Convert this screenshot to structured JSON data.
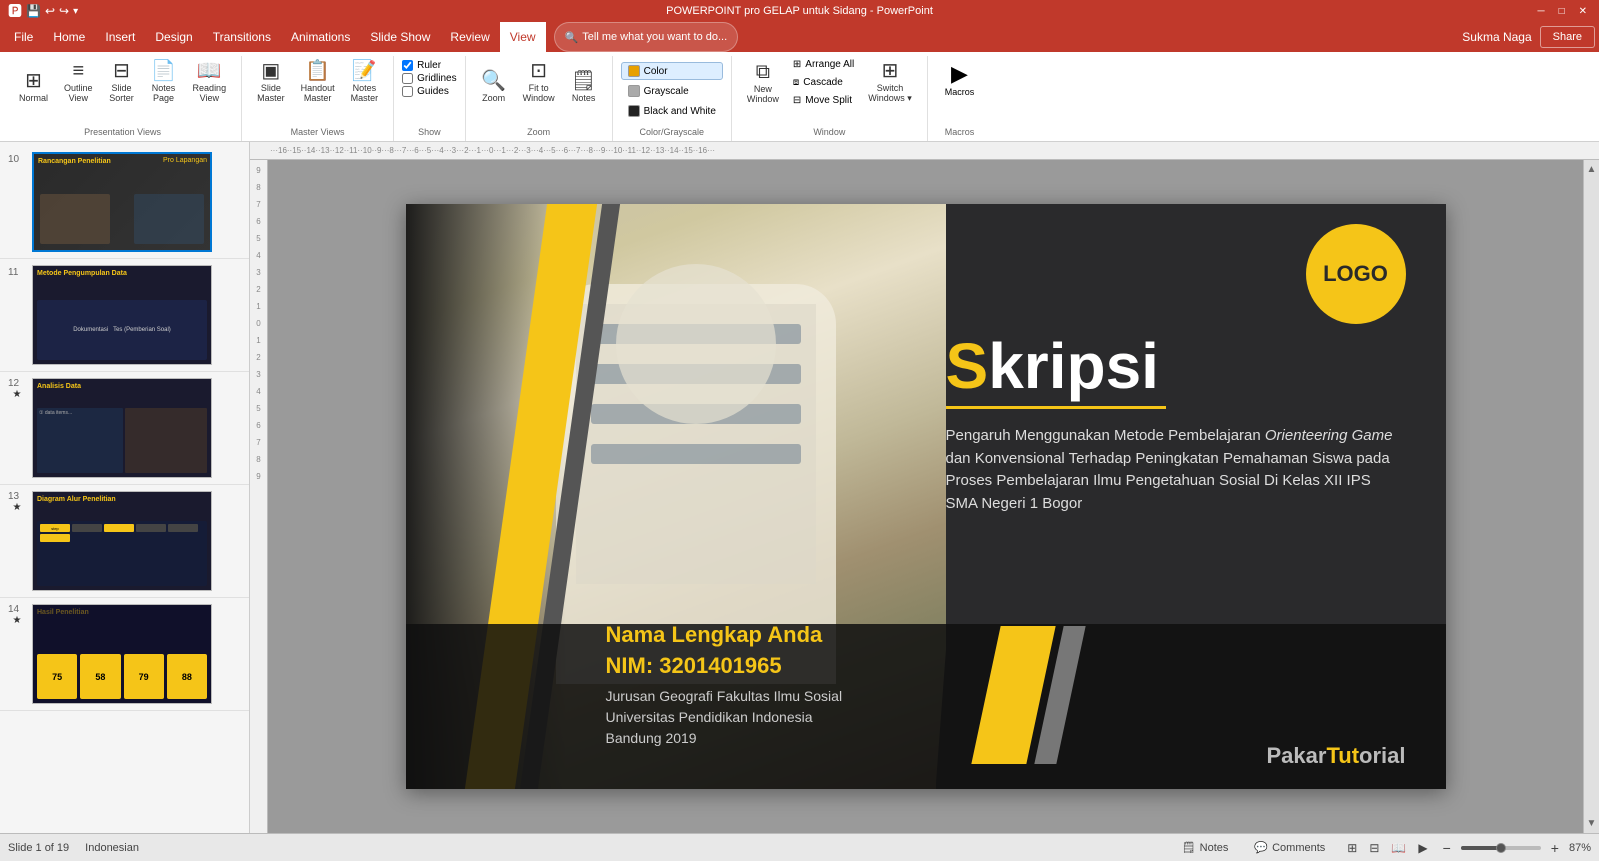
{
  "titlebar": {
    "title": "POWERPOINT pro GELAP untuk Sidang - PowerPoint",
    "controls": [
      "–",
      "□",
      "✕"
    ]
  },
  "qat": {
    "buttons": [
      "💾",
      "↩",
      "↪",
      "⚙",
      "💾",
      "▾"
    ]
  },
  "menubar": {
    "items": [
      "File",
      "Home",
      "Insert",
      "Design",
      "Transitions",
      "Animations",
      "Slide Show",
      "Review",
      "View"
    ],
    "active": "View",
    "tell_me": "Tell me what you want to do...",
    "user": "Sukma Naga",
    "share": "Share"
  },
  "ribbon": {
    "presentation_views": {
      "label": "Presentation Views",
      "buttons": [
        {
          "label": "Normal",
          "icon": "⊞"
        },
        {
          "label": "Outline\nView",
          "icon": "≡"
        },
        {
          "label": "Slide\nSorter",
          "icon": "⊟"
        },
        {
          "label": "Notes\nPage",
          "icon": "📄"
        },
        {
          "label": "Reading\nView",
          "icon": "📖"
        }
      ]
    },
    "master_views": {
      "label": "Master Views",
      "buttons": [
        {
          "label": "Slide\nMaster",
          "icon": "▣"
        },
        {
          "label": "Handout\nMaster",
          "icon": "📋"
        },
        {
          "label": "Notes\nMaster",
          "icon": "📝"
        }
      ]
    },
    "show": {
      "label": "Show",
      "checkboxes": [
        {
          "label": "Ruler",
          "checked": true
        },
        {
          "label": "Gridlines",
          "checked": false
        },
        {
          "label": "Guides",
          "checked": false
        }
      ]
    },
    "zoom": {
      "label": "Zoom",
      "buttons": [
        {
          "label": "Zoom",
          "icon": "🔍"
        },
        {
          "label": "Fit to\nWindow",
          "icon": "⊡"
        },
        {
          "label": "Notes",
          "icon": "🗒"
        }
      ]
    },
    "color": {
      "label": "Color/Grayscale",
      "items": [
        {
          "label": "Color",
          "active": true,
          "color": "#e8a000"
        },
        {
          "label": "Grayscale",
          "active": false,
          "color": "#aaa"
        },
        {
          "label": "Black and White",
          "active": false,
          "color": "#222"
        }
      ]
    },
    "window": {
      "label": "Window",
      "big_btn": {
        "label": "New\nWindow",
        "icon": "⧉"
      },
      "small_btns": [
        {
          "label": "Arrange All"
        },
        {
          "label": "Cascade"
        },
        {
          "label": "Move Split"
        }
      ],
      "switch_btn": {
        "label": "Switch\nWindows",
        "icon": "⊞"
      }
    },
    "macros": {
      "label": "Macros",
      "btn": {
        "label": "Macros",
        "icon": "▶"
      }
    }
  },
  "slides": [
    {
      "num": "10",
      "star": false,
      "label": "Rancangan Penelitian",
      "sublabel": "Pro Lapangan",
      "bg": "#2a2a2a"
    },
    {
      "num": "11",
      "star": false,
      "label": "Metode Pengumpulan Data",
      "bg": "#1a1a2e"
    },
    {
      "num": "12",
      "star": true,
      "label": "Analisis Data",
      "bg": "#1a1a2e"
    },
    {
      "num": "13",
      "star": true,
      "label": "Diagram Alur Penelitian",
      "bg": "#1a1a2e"
    },
    {
      "num": "14",
      "star": true,
      "label": "Hasil Penelitian",
      "bg": "#1a1a2e"
    }
  ],
  "slide_content": {
    "logo": "LOGO",
    "title_prefix": "S",
    "title_rest": "kripsi",
    "subtitle": "Pengaruh Menggunakan Metode Pembelajaran Orienteering Game dan Konvensional Terhadap Peningkatan Pemahaman Siswa pada Proses Pembelajaran Ilmu Pengetahuan Sosial Di Kelas XII IPS SMA Negeri 1 Bogor",
    "name": "Nama Lengkap Anda",
    "nim": "NIM: 3201401965",
    "dept": "Jurusan Geografi  Fakultas Ilmu Sosial\nUniversitas Pendidikan Indonesia\nBandung 2019",
    "brand1": "Pakar",
    "brand2": "Tut",
    "brand3": "orial"
  },
  "statusbar": {
    "slide_info": "Slide 1 of 19",
    "language": "Indonesian",
    "notes_label": "Notes",
    "comments_label": "Comments",
    "zoom_percent": "87%"
  },
  "colors": {
    "gold": "#f5c518",
    "dark_bg": "#2a2a2a",
    "ribbon_bg": "#ffffff",
    "menu_bg": "#c0392b",
    "accent": "#c0392b"
  }
}
